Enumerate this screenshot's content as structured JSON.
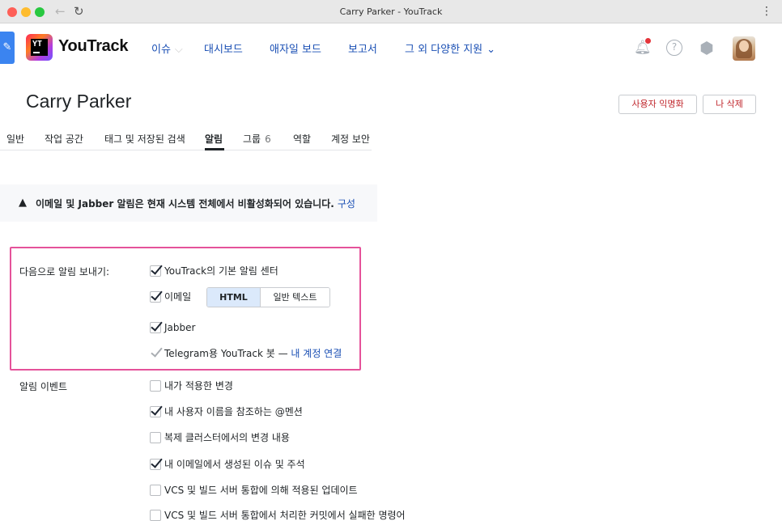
{
  "window": {
    "title": "Carry Parker - YouTrack"
  },
  "header": {
    "logo_text": "YouTrack",
    "logo_mark": "YT",
    "nav": [
      {
        "label": "이슈"
      },
      {
        "label": "대시보드"
      },
      {
        "label": "애자일 보드"
      },
      {
        "label": "보고서"
      },
      {
        "label": "그 외 다양한 지원"
      }
    ]
  },
  "page": {
    "title": "Carry Parker",
    "anonymize_label": "사용자 익명화",
    "delete_label": "나 삭제"
  },
  "tabs": [
    {
      "label": "일반"
    },
    {
      "label": "작업 공간"
    },
    {
      "label": "태그 및 저장된 검색"
    },
    {
      "label": "알림",
      "active": true
    },
    {
      "label": "그룹",
      "count": "6"
    },
    {
      "label": "역할"
    },
    {
      "label": "계정 보안"
    }
  ],
  "banner": {
    "message": "이메일 및 Jabber 알림은 현재 시스템 전체에서 비활성화되어 있습니다.",
    "link": "구성"
  },
  "send_via": {
    "label": "다음으로 알림 보내기:",
    "options": [
      {
        "label": "YouTrack의 기본 알림 센터",
        "checked": true
      },
      {
        "label": "이메일",
        "checked": true
      },
      {
        "label": "Jabber",
        "checked": true
      },
      {
        "label": "Telegram용 YouTrack 봇 —",
        "checked": true,
        "disabled": true,
        "link": "내 계정 연결"
      }
    ],
    "format": {
      "html": "HTML",
      "plain": "일반 텍스트",
      "selected": "HTML"
    }
  },
  "events": {
    "label": "알림 이벤트",
    "items": [
      {
        "label": "내가 적용한 변경",
        "checked": false
      },
      {
        "label": "내 사용자 이름을 참조하는 @멘션",
        "checked": true
      },
      {
        "label": "복제 클러스터에서의 변경 내용",
        "checked": false
      },
      {
        "label": "내 이메일에서 생성된 이슈 및 주석",
        "checked": true
      },
      {
        "label": "VCS 및 빌드 서버 통합에 의해 적용된 업데이트",
        "checked": false
      },
      {
        "label": "VCS 및 빌드 서버 통합에서 처리한 커밋에서 실패한 명령어",
        "checked": false
      }
    ]
  },
  "icons": {
    "back": "arrow-left-icon",
    "reload": "reload-icon",
    "menu": "kebab-menu-icon",
    "bell": "bell-icon",
    "help": "help-icon",
    "admin": "hexagon-settings-icon",
    "warning": "warning-icon"
  }
}
